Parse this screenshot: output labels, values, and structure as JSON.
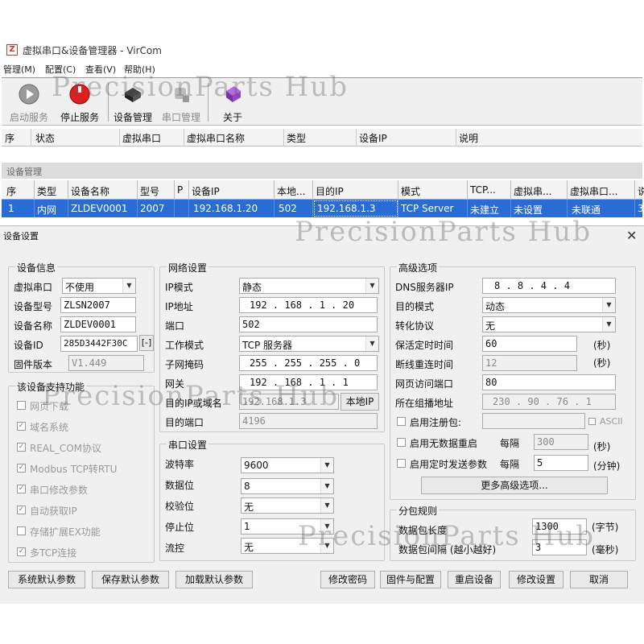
{
  "window": {
    "title": "虚拟串口&设备管理器 - VirCom",
    "icon_letter": "Z"
  },
  "menu": [
    "管理(M)",
    "配置(C)",
    "查看(V)",
    "帮助(H)"
  ],
  "toolbar": {
    "start_service": "启动服务",
    "stop_service": "停止服务",
    "device_manage": "设备管理",
    "port_manage": "串口管理",
    "about": "关于"
  },
  "main_list": {
    "columns": [
      "序",
      "状态",
      "虚拟串口",
      "虚拟串口名称",
      "类型",
      "设备IP",
      "说明"
    ]
  },
  "device_section_label": "设备管理",
  "device_grid": {
    "columns": [
      "序",
      "类型",
      "设备名称",
      "型号",
      "P",
      "设备IP",
      "本地...",
      "目的IP",
      "模式",
      "TCP...",
      "虚拟串...",
      "虚拟串口...",
      "说"
    ],
    "row": [
      "1",
      "内网",
      "ZLDEV0001",
      "2007",
      "",
      "192.168.1.20",
      "502",
      "192.168.1.3",
      "TCP Server",
      "未建立",
      "未设置",
      "未联通",
      "3"
    ]
  },
  "dialog": {
    "title": "设备设置",
    "close": "✕",
    "device_info": {
      "title": "设备信息",
      "virtual_port_label": "虚拟串口",
      "virtual_port_value": "不使用",
      "model_label": "设备型号",
      "model_value": "ZLSN2007",
      "name_label": "设备名称",
      "name_value": "ZLDEV0001",
      "id_label": "设备ID",
      "id_value": "285D3442F30C",
      "id_btn": "[-]",
      "firmware_label": "固件版本",
      "firmware_value": "V1.449"
    },
    "features": {
      "title": "该设备支持功能",
      "items": [
        "网页下载",
        "域名系统",
        "REAL_COM协议",
        "Modbus TCP转RTU",
        "串口修改参数",
        "自动获取IP",
        "存储扩展EX功能",
        "多TCP连接"
      ],
      "checked": [
        false,
        true,
        true,
        true,
        true,
        true,
        false,
        true
      ]
    },
    "network": {
      "title": "网络设置",
      "ip_mode_label": "IP模式",
      "ip_mode_value": "静态",
      "ip_label": "IP地址",
      "ip_value": "192 . 168 . 1 . 20",
      "port_label": "端口",
      "port_value": "502",
      "work_mode_label": "工作模式",
      "work_mode_value": "TCP 服务器",
      "mask_label": "子网掩码",
      "mask_value": "255 . 255 . 255 . 0",
      "gateway_label": "网关",
      "gateway_value": "192 . 168 . 1 . 1",
      "dest_ip_label": "目的IP或域名",
      "dest_ip_value": "192.168.1.3",
      "local_ip_btn": "本地IP",
      "dest_port_label": "目的端口",
      "dest_port_value": "4196"
    },
    "serial": {
      "title": "串口设置",
      "baud_label": "波特率",
      "baud_value": "9600",
      "databits_label": "数据位",
      "databits_value": "8",
      "parity_label": "校验位",
      "parity_value": "无",
      "stopbits_label": "停止位",
      "stopbits_value": "1",
      "flow_label": "流控",
      "flow_value": "无"
    },
    "advanced": {
      "title": "高级选项",
      "dns_label": "DNS服务器IP",
      "dns_value": "8 . 8 . 4 . 4",
      "dest_mode_label": "目的模式",
      "dest_mode_value": "动态",
      "protocol_label": "转化协议",
      "protocol_value": "无",
      "keepalive_label": "保活定时时间",
      "keepalive_value": "60",
      "keepalive_unit": "(秒)",
      "reconnect_label": "断线重连时间",
      "reconnect_value": "12",
      "reconnect_unit": "(秒)",
      "web_port_label": "网页访问端口",
      "web_port_value": "80",
      "multicast_label": "所在组播地址",
      "multicast_value": "230 . 90 . 76 . 1",
      "reg_label": "启用注册包:",
      "ascii_label": "ASCII",
      "nodata_label": "启用无数据重启",
      "nodata_every": "每隔",
      "nodata_value": "300",
      "nodata_unit": "(秒)",
      "timer_label": "启用定时发送参数",
      "timer_every": "每隔",
      "timer_value": "5",
      "timer_unit": "(分钟)",
      "more_btn": "更多高级选项..."
    },
    "packet": {
      "title": "分包规则",
      "len_label": "数据包长度",
      "len_value": "1300",
      "len_unit": "(字节)",
      "interval_label": "数据包间隔 (越小越好)",
      "interval_value": "3",
      "interval_unit": "(毫秒)"
    },
    "buttons": [
      "系统默认参数",
      "保存默认参数",
      "加载默认参数",
      "修改密码",
      "固件与配置",
      "重启设备",
      "修改设置",
      "取消"
    ]
  },
  "watermark": "PrecisionParts Hub"
}
